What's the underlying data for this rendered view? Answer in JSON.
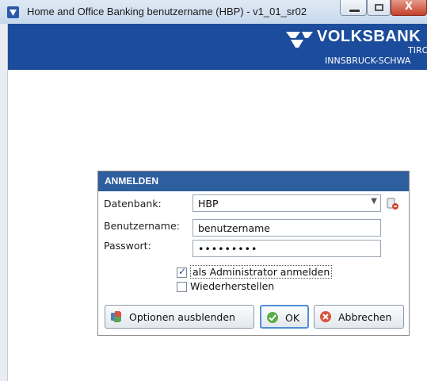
{
  "window": {
    "title": "Home and Office Banking benutzername (HBP) - v1_01_sr02",
    "close_glyph": "X"
  },
  "banner": {
    "brand_name": "VOLKSBANK",
    "brand_line1": "TIRO",
    "brand_line2": "INNSBRUCK-SCHWA",
    "background_color": "#1c4d9c"
  },
  "dialog": {
    "title": "ANMELDEN",
    "header_color": "#2d5e9e",
    "fields": {
      "database_label": "Datenbank:",
      "database_value": "HBP",
      "username_label": "Benutzername:",
      "username_value": "benutzername",
      "password_label": "Passwort:",
      "password_value": "•••••••••"
    },
    "checkboxes": {
      "admin_label": "als Administrator anmelden",
      "admin_checked": true,
      "restore_label": "Wiederherstellen",
      "restore_checked": false
    },
    "buttons": {
      "options_label": "Optionen ausblenden",
      "ok_label": "OK",
      "cancel_label": "Abbrechen"
    },
    "icons": {
      "options": "options-icon",
      "ok": "ok-check-icon",
      "cancel": "cancel-x-icon",
      "database_addon": "database-settings-icon"
    }
  }
}
